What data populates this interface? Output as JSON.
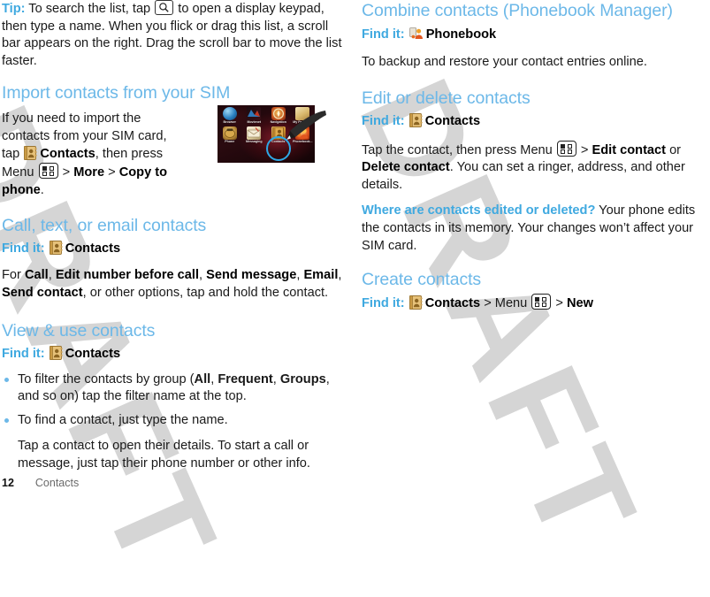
{
  "watermark": {
    "text": "DRAFT"
  },
  "colors": {
    "heading_blue": "#6cb8e8",
    "label_blue": "#3fa9e0",
    "body_black": "#1a1a1a",
    "footer_gray": "#6a6a6a",
    "highlight_circle": "#2ea8e6"
  },
  "left_column": {
    "tip": {
      "label": "Tip:",
      "text_before_icon": " To search the list, tap ",
      "icon": "search-icon",
      "text_after_icon": " to open a display keypad, then type a name. When you flick or drag this list, a scroll bar appears on the right. Drag the scroll bar to move the list faster."
    },
    "import_section": {
      "heading": "Import contacts from your SIM",
      "para_1": "If you need to import the contacts from your SIM card, tap ",
      "contacts_label": "Contacts",
      "para_2": ", then press Menu ",
      "para_3": " > ",
      "more_label": "More",
      "para_4": " > ",
      "copy_label": "Copy to phone",
      "para_5": "."
    },
    "call_section": {
      "heading": "Call, text, or email contacts",
      "find_it_label": "Find it:",
      "find_it_target": "Contacts",
      "body_prefix": "For ",
      "options": [
        "Call",
        "Edit number before call",
        "Send message",
        "Email",
        "Send contact"
      ],
      "body_suffix": ", or other options, tap and hold the contact."
    },
    "view_section": {
      "heading": "View & use contacts",
      "find_it_label": "Find it:",
      "find_it_target": "Contacts",
      "bullets": [
        {
          "prefix": "To filter the contacts by group (",
          "bold_terms": [
            "All",
            "Frequent",
            "Groups"
          ],
          "suffix": ", and so on) tap the filter name at the top."
        },
        {
          "prefix": "To find a contact, just type the name.",
          "bold_terms": [],
          "suffix": ""
        }
      ],
      "sub_paragraph": "Tap a contact to open their details. To start a call or message, just tap their phone number or other info."
    }
  },
  "right_column": {
    "combine_section": {
      "heading": "Combine contacts (Phonebook Manager)",
      "find_it_label": "Find it:",
      "find_it_target": "Phonebook",
      "body": "To backup and restore your contact entries online."
    },
    "edit_section": {
      "heading": "Edit or delete contacts",
      "find_it_label": "Find it:",
      "find_it_target": "Contacts",
      "body_1": "Tap the contact, then press Menu ",
      "body_2": " > ",
      "edit_label": "Edit contact",
      "body_3": " or ",
      "delete_label": "Delete contact",
      "body_4": ". You can set a ringer, address, and other details."
    },
    "note": {
      "question": "Where are contacts edited or deleted?",
      "answer": " Your phone edits the contacts in its memory. Your changes won’t affect your SIM card."
    },
    "create_section": {
      "heading": "Create contacts",
      "find_it_label": "Find it:",
      "find_it_target": "Contacts",
      "sep_1": " > ",
      "menu_word": "Menu",
      "sep_2": " > ",
      "new_label": "New"
    }
  },
  "phone_figure": {
    "caption_alt": "phone home screen with Contacts highlighted",
    "apps": [
      {
        "label": "Browser",
        "glyph": "globe-icon"
      },
      {
        "label": "Movienet",
        "glyph": "movie-icon"
      },
      {
        "label": "Navigation",
        "glyph": "compass-icon"
      },
      {
        "label": "My Favorites",
        "glyph": "folder-icon"
      },
      {
        "label": "Phone",
        "glyph": "phone-icon"
      },
      {
        "label": "Messaging",
        "glyph": "envelope-icon"
      },
      {
        "label": "Contacts",
        "glyph": "address-book-icon"
      },
      {
        "label": "Phonebook...",
        "glyph": "phonebook-icon"
      }
    ],
    "highlighted_app": "Contacts"
  },
  "footer": {
    "page_number": "12",
    "chapter": "Contacts"
  }
}
